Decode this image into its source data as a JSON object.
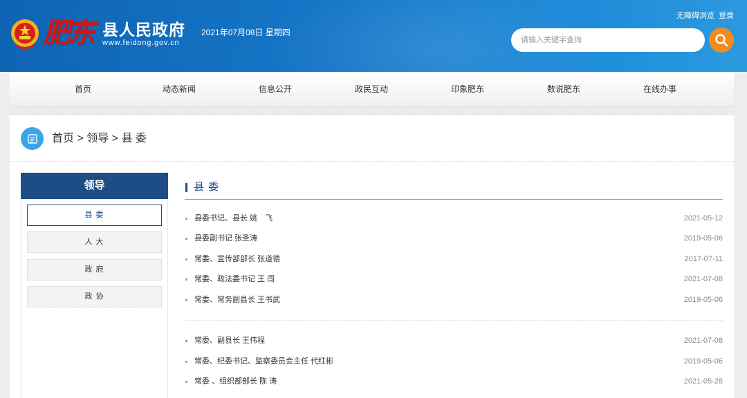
{
  "header": {
    "calligraphy": "肥东",
    "site_title": "县人民政府",
    "site_domain": "www.feidong.gov.cn",
    "date": "2021年07月08日 星期四",
    "links": [
      "无障碍浏览",
      "登录"
    ],
    "search_placeholder": "请输入关键字查询",
    "accent_color": "#f28c1e"
  },
  "nav": {
    "items": [
      "首页",
      "动态新闻",
      "信息公开",
      "政民互动",
      "印象肥东",
      "数说肥东",
      "在线办事"
    ]
  },
  "breadcrumb": {
    "text": "首页 > 领导 > 县 委"
  },
  "sidebar": {
    "title": "领导",
    "items": [
      "县 委",
      "人 大",
      "政 府",
      "政 协"
    ],
    "active_index": 0
  },
  "main": {
    "title": "县 委",
    "group1": [
      {
        "name": "县委书记、县长 姚　飞",
        "date": "2021-05-12"
      },
      {
        "name": "县委副书记 张圣涛",
        "date": "2019-05-06"
      },
      {
        "name": "常委、宣传部部长 张道德",
        "date": "2017-07-11"
      },
      {
        "name": "常委、政法委书记 王 闯",
        "date": "2021-07-08"
      },
      {
        "name": "常委、常务副县长 王书武",
        "date": "2019-05-06"
      }
    ],
    "group2": [
      {
        "name": "常委、副县长 王伟程",
        "date": "2021-07-08"
      },
      {
        "name": "常委、纪委书记、监察委员会主任 代红彬",
        "date": "2019-05-06"
      },
      {
        "name": "常委 、组织部部长 陈 涛",
        "date": "2021-05-28"
      }
    ]
  }
}
